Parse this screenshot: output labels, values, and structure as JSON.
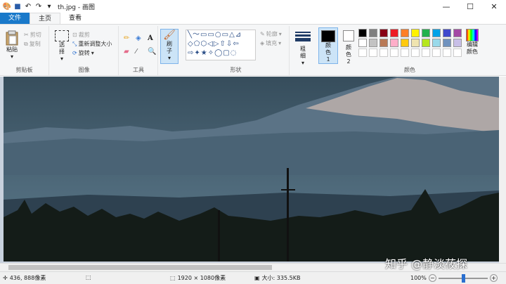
{
  "window": {
    "title": "th.jpg - 画图",
    "minimize": "—",
    "maximize": "☐",
    "close": "✕"
  },
  "tabs": [
    "文件",
    "主页",
    "查看"
  ],
  "clipboard": {
    "paste": "粘贴",
    "cut": "剪切",
    "copy": "复制",
    "label": "剪贴板"
  },
  "image": {
    "select": "选择",
    "crop": "裁剪",
    "resize": "重新调整大小",
    "rotate": "旋转",
    "label": "图像"
  },
  "tools": {
    "label": "工具",
    "text": "A"
  },
  "brush": {
    "label": "刷子"
  },
  "shapes": {
    "outline": "轮廓",
    "fill": "填充",
    "label": "形状"
  },
  "size": {
    "label": "粗细"
  },
  "color1": {
    "label": "颜色 1",
    "value": "#000000"
  },
  "color2": {
    "label": "颜色 2",
    "value": "#ffffff"
  },
  "colors": {
    "label": "颜色",
    "edit": "编辑颜色"
  },
  "palette": [
    "#000000",
    "#7f7f7f",
    "#880015",
    "#ed1c24",
    "#ff7f27",
    "#fff200",
    "#22b14c",
    "#00a2e8",
    "#3f48cc",
    "#a349a4",
    "#ffffff",
    "#c3c3c3",
    "#b97a57",
    "#ffaec9",
    "#ffc90e",
    "#efe4b0",
    "#b5e61d",
    "#99d9ea",
    "#7092be",
    "#c8bfe7"
  ],
  "status": {
    "cursor": "436, 888像素",
    "dimensions": "1920 × 1080像素",
    "filesize": "大小: 335.5KB",
    "zoom": "100%"
  },
  "watermark": "知乎 @静淡莜探"
}
